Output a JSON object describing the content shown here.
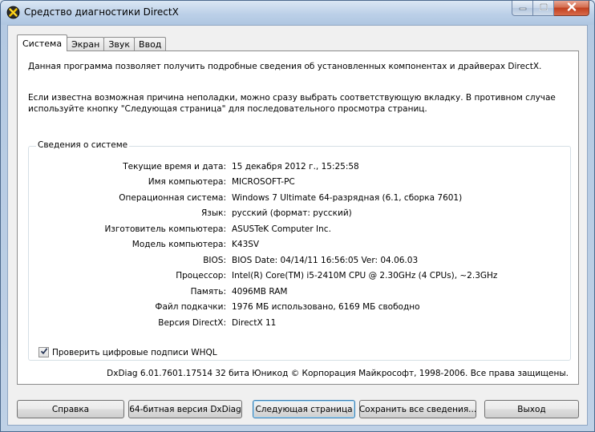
{
  "window": {
    "title": "Средство диагностики DirectX"
  },
  "tabs": [
    {
      "label": "Система",
      "active": true
    },
    {
      "label": "Экран",
      "active": false
    },
    {
      "label": "Звук",
      "active": false
    },
    {
      "label": "Ввод",
      "active": false
    }
  ],
  "intro": {
    "line1": "Данная программа позволяет получить подробные сведения об установленных компонентах и драйверах DirectX.",
    "line2": "Если известна возможная причина неполадки, можно сразу выбрать соответствующую вкладку. В противном случае используйте кнопку \"Следующая страница\" для последовательного просмотра страниц."
  },
  "system_info": {
    "group_title": "Сведения о системе",
    "rows": [
      {
        "label": "Текущие время и дата:",
        "value": "15 декабря 2012 г., 15:25:58"
      },
      {
        "label": "Имя компьютера:",
        "value": "MICROSOFT-PC"
      },
      {
        "label": "Операционная система:",
        "value": "Windows 7 Ultimate 64-разрядная (6.1, сборка 7601)"
      },
      {
        "label": "Язык:",
        "value": "русский (формат: русский)"
      },
      {
        "label": "Изготовитель компьютера:",
        "value": "ASUSTeK Computer Inc."
      },
      {
        "label": "Модель компьютера:",
        "value": "K43SV"
      },
      {
        "label": "BIOS:",
        "value": "BIOS Date: 04/14/11 16:56:05 Ver: 04.06.03"
      },
      {
        "label": "Процессор:",
        "value": "Intel(R) Core(TM) i5-2410M CPU @ 2.30GHz (4 CPUs), ~2.3GHz"
      },
      {
        "label": "Память:",
        "value": "4096MB RAM"
      },
      {
        "label": "Файл подкачки:",
        "value": "1976 МБ использовано, 6169 МБ свободно"
      },
      {
        "label": "Версия DirectX:",
        "value": "DirectX 11"
      }
    ],
    "whql_label": "Проверить цифровые подписи WHQL",
    "whql_checked": true
  },
  "footer": {
    "version_line": "DxDiag 6.01.7601.17514 32 бита Юникод  © Корпорация Майкрософт, 1998-2006.  Все права защищены."
  },
  "buttons": {
    "help": "Справка",
    "dxdiag64": "64-битная версия DxDiag",
    "next_page": "Следующая страница",
    "save_all": "Сохранить все сведения...",
    "exit": "Выход"
  },
  "icons": {
    "app": "directx-icon",
    "minimize": "minimize-icon",
    "maximize": "maximize-icon",
    "close": "close-icon",
    "checkmark": "checkmark-icon"
  },
  "colors": {
    "title_gradient": "#bcd0e8",
    "close_button": "#c1401f",
    "default_button_border": "#3c7fb1"
  }
}
